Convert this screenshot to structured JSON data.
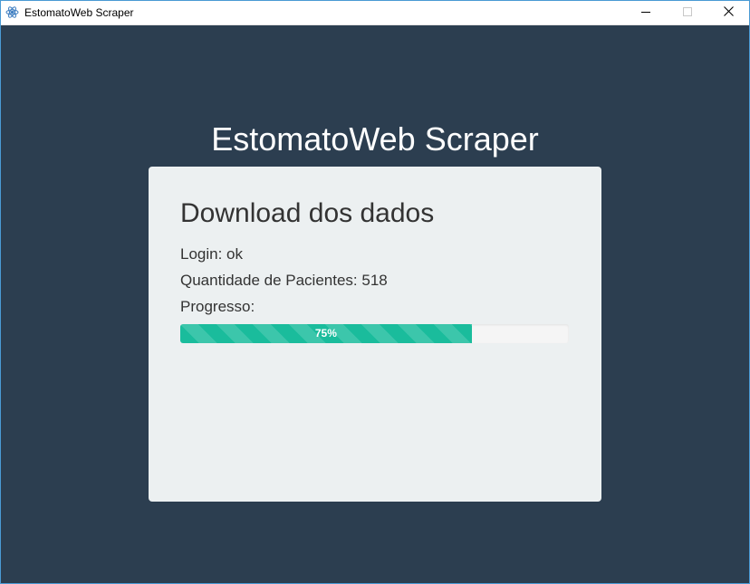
{
  "window": {
    "title": "EstomatoWeb Scraper",
    "app_icon": "atom-icon",
    "controls": {
      "minimize_icon": "minimize-icon",
      "maximize_icon": "maximize-icon",
      "close_icon": "close-icon"
    }
  },
  "page": {
    "title": "EstomatoWeb Scraper"
  },
  "card": {
    "heading": "Download dos dados",
    "login_text": "Login: ok",
    "quantity_text": "Quantidade de Pacientes: 518",
    "progress_label": "Progresso:",
    "progress": {
      "value": 0.75,
      "label": "75%"
    }
  },
  "colors": {
    "background": "#2c3e50",
    "card": "#ecf0f1",
    "accent": "#1abc9c",
    "text": "#333333"
  }
}
